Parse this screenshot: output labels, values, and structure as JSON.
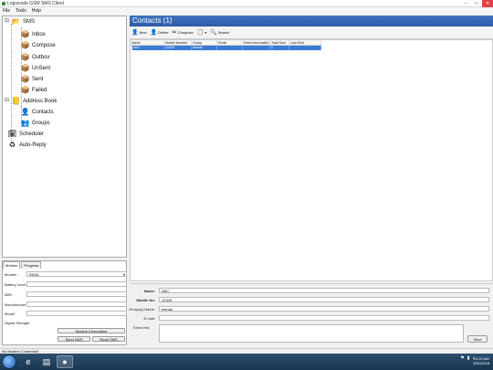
{
  "window": {
    "title": "Logiscode GSM SMS Client",
    "buttons": [
      "–",
      "□",
      "✕"
    ]
  },
  "menu": [
    "File",
    "Tools",
    "Help"
  ],
  "nav": {
    "root": "SMS",
    "sms_items": [
      "Inbox",
      "Compose",
      "Outbox",
      "UnSent",
      "Sent",
      "Failed"
    ],
    "address_book": "Address Book",
    "address_items": [
      "Contacts",
      "Groups"
    ],
    "scheduler": "Scheduler",
    "auto_reply": "Auto-Reply"
  },
  "modem": {
    "tabs": [
      "Modem",
      "Progress"
    ],
    "modem_label": "Modem",
    "modem_value": "INDIA",
    "battery_label": "Battery Level",
    "imei_label": "IMEI",
    "manufacturer_label": "Manufacturer",
    "model_label": "Model",
    "signal_label": "Signal Strength",
    "info_button": "Modem Information",
    "send_button": "Send SMS",
    "read_button": "Read SMS"
  },
  "content": {
    "header": "Contacts (1)",
    "toolbar": {
      "new": "New",
      "delete": "Delete",
      "compose": "Compose",
      "search": "Search"
    },
    "columns": [
      "Name",
      "Mobile Number",
      "Group",
      "Email",
      "Extra Information",
      "Total Sent",
      "Last Sent"
    ],
    "rows": [
      [
        "ABC",
        "12345",
        "friends",
        "",
        "",
        "0",
        ""
      ]
    ]
  },
  "details": {
    "name_label": "Name:",
    "name_value": "ABC",
    "mobile_label": "Mobile No:",
    "mobile_value": "12345",
    "group_label": "Group(s) Name:",
    "group_value": "friends",
    "email_label": "E-mail:",
    "email_value": "",
    "extra_label": "Extra Info:",
    "extra_value": "",
    "save_button": "Save"
  },
  "status": "No Modem Connected",
  "taskbar": {
    "time": "10:22 AM",
    "date": "3/31/2018"
  },
  "colors": {
    "header_blue": "#2d5aa6",
    "selection": "#3a7bd5"
  }
}
